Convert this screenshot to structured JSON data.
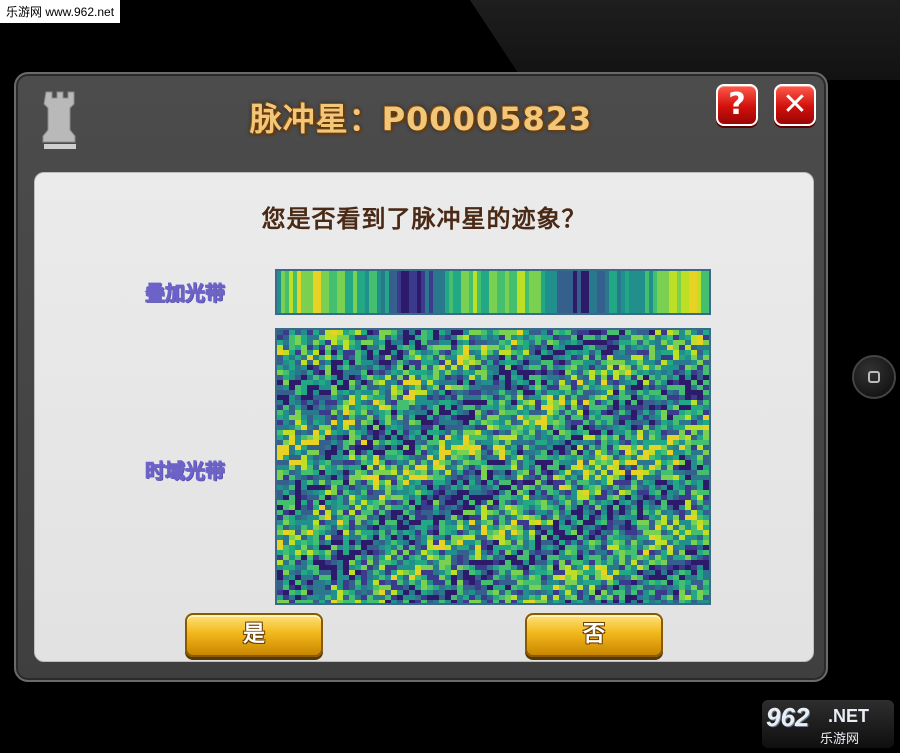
{
  "watermark": {
    "site_text": "乐游网 www.962.net",
    "logo_number": "962",
    "logo_suffix": ".NET",
    "logo_cn": "乐游网"
  },
  "dialog": {
    "title": "脉冲星：P00005823",
    "question": "您是否看到了脉冲星的迹象？",
    "help_label": "?",
    "close_label": "✕",
    "overlay_band_label": "叠加光带",
    "time_band_label": "时域光带",
    "yes_label": "是",
    "no_label": "否"
  },
  "icons": {
    "rook": "chess-rook-icon",
    "home": "home-button-icon"
  },
  "colors": {
    "title": "#f2c77a",
    "question": "#4a2a16",
    "button_gold": "#f2b81c",
    "button_red": "#d0100c",
    "band_label": "#6c62c8"
  }
}
